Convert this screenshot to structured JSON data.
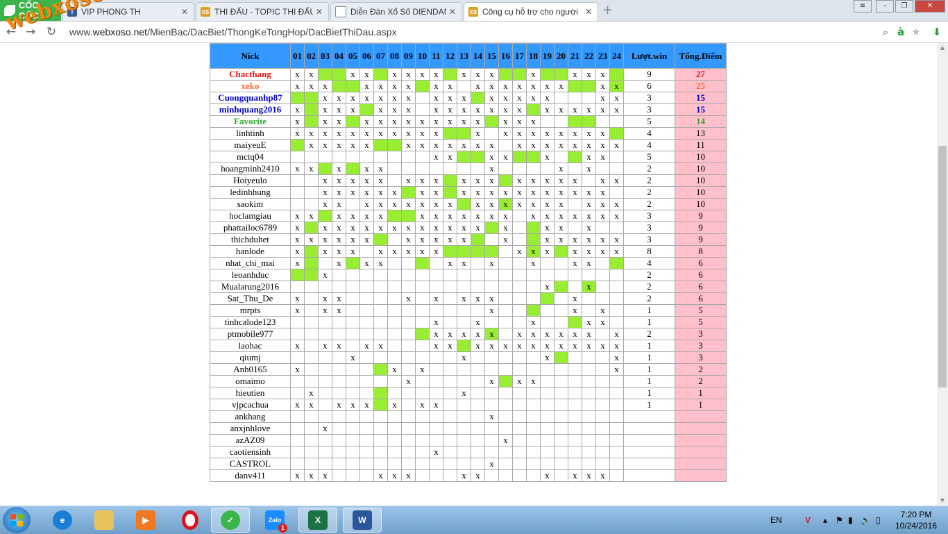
{
  "browser": {
    "brand": "CỐC CỐC",
    "tabs": [
      {
        "title": "VIP PHONG TH",
        "icon": "facebook-icon"
      },
      {
        "title": "THI ĐẤU - TOPIC THI ĐẤU",
        "icon": "xs-site-icon"
      },
      {
        "title": "Diễn Đàn Xổ Số DIENDAN",
        "icon": "page-icon"
      },
      {
        "title": "Công cụ hỗ trợ cho người",
        "icon": "xs-site-icon"
      }
    ],
    "url_host": "webxoso.net",
    "url_path": "/MienBac/DacBiet/ThongKeTongHop/DacBietThiDau.aspx",
    "url_prefix": "www.",
    "watermark": "webxoso.net"
  },
  "table": {
    "headers": {
      "nick": "Nick",
      "win": "Lượt.win",
      "points": "Tổng.Điểm"
    },
    "columns": [
      "01",
      "02",
      "03",
      "04",
      "05",
      "06",
      "07",
      "08",
      "09",
      "10",
      "11",
      "12",
      "13",
      "14",
      "15",
      "16",
      "17",
      "18",
      "19",
      "20",
      "21",
      "22",
      "23",
      "24"
    ],
    "rows": [
      {
        "nick": "Chacthang",
        "style": "red",
        "cells": "xx..xx.xxxx.xxx..x..xxx.",
        "green": [
          3,
          4,
          7,
          12,
          16,
          17,
          19,
          20,
          24
        ],
        "win": "9",
        "points": "27"
      },
      {
        "nick": "xeko",
        "style": "orange",
        "cells": "xxx..xxxx.xx.xxxxxxx..xx",
        "green": [
          4,
          5,
          10,
          21,
          22,
          24
        ],
        "win": "6",
        "points": "25"
      },
      {
        "nick": "Cuongquanhp87",
        "style": "blue",
        "cells": "..xxxxxxx.xxx.xxxxx...xx",
        "green": [
          1,
          2,
          14
        ],
        "win": "3",
        "points": "15"
      },
      {
        "nick": "minhquang2016",
        "style": "blue",
        "cells": "x.xxx.xxx.xxxxxxx.xxxxxx",
        "green": [
          2,
          6,
          18
        ],
        "win": "3",
        "points": "15"
      },
      {
        "nick": "Favorite",
        "style": "green",
        "cells": "x.xx.xxxxxxxxx.xxx......",
        "green": [
          2,
          5,
          15,
          21,
          22
        ],
        "win": "5",
        "points": "14"
      },
      {
        "nick": "linhtinh",
        "style": "",
        "cells": "xxxxxxxxxxx..x.xxxxxxxx.",
        "green": [
          12,
          13,
          24
        ],
        "win": "4",
        "points": "13"
      },
      {
        "nick": "maiyeuE",
        "style": "",
        "cells": ".xxxxx..xxxxxxx.xxxxxxxx",
        "green": [
          1,
          7,
          8
        ],
        "win": "4",
        "points": "11"
      },
      {
        "nick": "mctq04",
        "style": "",
        "cells": "..........xx..xx..x..xx.",
        "green": [
          13,
          14,
          17,
          18,
          21
        ],
        "win": "5",
        "points": "10"
      },
      {
        "nick": "hoangminh2410",
        "style": "",
        "cells": "xx.x.xx.......x....x.x..",
        "green": [
          3,
          5
        ],
        "win": "2",
        "points": "10"
      },
      {
        "nick": "Hoiyeulo",
        "style": "",
        "cells": "..xxxxx.xxx.xxx.xxxxx.xx",
        "green": [
          12,
          16
        ],
        "win": "2",
        "points": "10"
      },
      {
        "nick": "ledinhhung",
        "style": "",
        "cells": "..xxxxxx.xx.xxxxxxxxxxx.",
        "green": [
          9,
          12
        ],
        "win": "2",
        "points": "10"
      },
      {
        "nick": "saokim",
        "style": "",
        "cells": "..xx.xxxxxxx.xxxxxxx.xxx",
        "green": [
          13,
          16
        ],
        "win": "2",
        "points": "10"
      },
      {
        "nick": "hoclamgiau",
        "style": "",
        "cells": "xx.xxxx..xxxxxxx.xxxxxxx",
        "green": [
          3,
          8,
          9
        ],
        "win": "3",
        "points": "9"
      },
      {
        "nick": "phattailoc6789",
        "style": "",
        "cells": "x.xxxxxxxxxxxx.x..xx.x..",
        "green": [
          2,
          15,
          18
        ],
        "win": "3",
        "points": "9"
      },
      {
        "nick": "thichduhet",
        "style": "",
        "cells": "xxxxxx..xxxxx..x..xxxxxx",
        "green": [
          7,
          14,
          18
        ],
        "win": "3",
        "points": "9"
      },
      {
        "nick": "hanlode",
        "style": "",
        "cells": "x.xxx.xxxxx.....xxx.xxxx",
        "green": [
          2,
          12,
          13,
          14,
          15,
          18,
          20
        ],
        "win": "8",
        "points": "8"
      },
      {
        "nick": "nhat_chi_mai",
        "style": "",
        "cells": "x..x.xx....xx.x..x..xx..",
        "green": [
          2,
          5,
          10,
          24
        ],
        "win": "4",
        "points": "6"
      },
      {
        "nick": "leoanhduc",
        "style": "",
        "cells": "..x.....................",
        "green": [
          1,
          2
        ],
        "win": "2",
        "points": "6"
      },
      {
        "nick": "Mualarung2016",
        "style": "",
        "cells": "..................x..x..",
        "green": [
          20,
          22
        ],
        "win": "2",
        "points": "6"
      },
      {
        "nick": "Sat_Thu_De",
        "style": "",
        "cells": "x.xx....x.x.xxx.....x...",
        "green": [
          19
        ],
        "win": "2",
        "points": "6"
      },
      {
        "nick": "mrpts",
        "style": "",
        "cells": "x.xx..........x.....x.x.x",
        "green": [
          18
        ],
        "win": "1",
        "points": "5"
      },
      {
        "nick": "tinhcalode123",
        "style": "",
        "cells": "..........x..x...x...xx.",
        "green": [
          21
        ],
        "win": "1",
        "points": "5"
      },
      {
        "nick": "ptmobile977",
        "style": "",
        "cells": "..........xxxxx.xxxxxx.x",
        "green": [
          10,
          15
        ],
        "win": "2",
        "points": "3"
      },
      {
        "nick": "laohac",
        "style": "",
        "cells": "x.xx.xx...xx.xxxxxxxxxxx",
        "green": [
          13
        ],
        "win": "1",
        "points": "3"
      },
      {
        "nick": "qiumj",
        "style": "",
        "cells": "....x.......x.....x....x",
        "green": [
          20
        ],
        "win": "1",
        "points": "3"
      },
      {
        "nick": "Anh0165",
        "style": "",
        "cells": "x......x.x.............x",
        "green": [
          7
        ],
        "win": "1",
        "points": "2"
      },
      {
        "nick": "omaimo",
        "style": "",
        "cells": "........x.....x.xx......",
        "green": [
          16
        ],
        "win": "1",
        "points": "2"
      },
      {
        "nick": "hieutien",
        "style": "",
        "cells": ".x..........x...........",
        "green": [
          7
        ],
        "win": "1",
        "points": "1"
      },
      {
        "nick": "vjpcachua",
        "style": "",
        "cells": "xx.xxx.x.xx.............",
        "green": [
          7
        ],
        "win": "1",
        "points": "1"
      },
      {
        "nick": "ankhang",
        "style": "",
        "cells": "..............x.........",
        "green": [],
        "win": "",
        "points": ""
      },
      {
        "nick": "anxjnhlove",
        "style": "",
        "cells": "..x.....................",
        "green": [],
        "win": "",
        "points": ""
      },
      {
        "nick": "azAZ09",
        "style": "",
        "cells": "...............x........",
        "green": [],
        "win": "",
        "points": ""
      },
      {
        "nick": "caotiensinh",
        "style": "",
        "cells": "..........x.............",
        "green": [],
        "win": "",
        "points": ""
      },
      {
        "nick": "CASTROL",
        "style": "",
        "cells": "..............x.........",
        "green": [],
        "win": "",
        "points": ""
      },
      {
        "nick": "danv411",
        "style": "",
        "cells": "xxx...xxx...xx....x.xxx.",
        "green": [],
        "win": "",
        "points": ""
      }
    ]
  },
  "taskbar": {
    "apps": [
      "internet-explorer-icon",
      "file-explorer-icon",
      "media-player-icon",
      "opera-icon",
      "coccoc-icon",
      "zalo-icon",
      "excel-icon",
      "word-icon"
    ],
    "zalo_label": "Zalo",
    "zalo_badge": "1",
    "language": "EN",
    "time": "7:20 PM",
    "date": "10/24/2016"
  }
}
